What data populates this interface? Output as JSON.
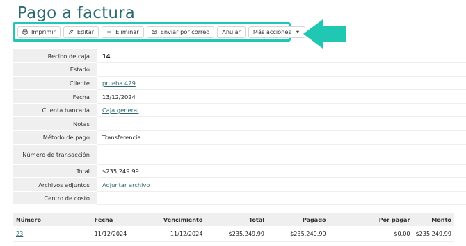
{
  "page": {
    "title": "Pago a factura"
  },
  "toolbar": {
    "print_label": "Imprimir",
    "edit_label": "Editar",
    "delete_label": "Eliminar",
    "email_label": "Enviar por correo",
    "void_label": "Anular",
    "more_label": "Más acciones"
  },
  "colors": {
    "highlight": "#20c8b4",
    "accent": "#2d6a73"
  },
  "details": [
    {
      "label": "Recibo de caja",
      "value": "14"
    },
    {
      "label": "Estado",
      "value": ""
    },
    {
      "label": "Cliente",
      "value": "prueba 429"
    },
    {
      "label": "Fecha",
      "value": "13/12/2024"
    },
    {
      "label": "Cuenta bancaria",
      "value": "Caja general"
    },
    {
      "label": "Notas",
      "value": ""
    },
    {
      "label": "Método de pago",
      "value": "Transferencia"
    },
    {
      "label": "Número de transacción",
      "value": ""
    },
    {
      "label": "Total",
      "value": "$235,249.99"
    },
    {
      "label": "Archivos adjuntos",
      "value": "Adjuntar archivo"
    },
    {
      "label": "Centro de costo",
      "value": ""
    }
  ],
  "invoices": {
    "headers": [
      "Número",
      "Fecha",
      "Vencimiento",
      "Total",
      "Pagado",
      "Por pagar",
      "Monto"
    ],
    "rows": [
      [
        "23",
        "11/12/2024",
        "11/12/2024",
        "$235,249.99",
        "$235,249.99",
        "$0.00",
        "$235,249.99"
      ]
    ]
  }
}
